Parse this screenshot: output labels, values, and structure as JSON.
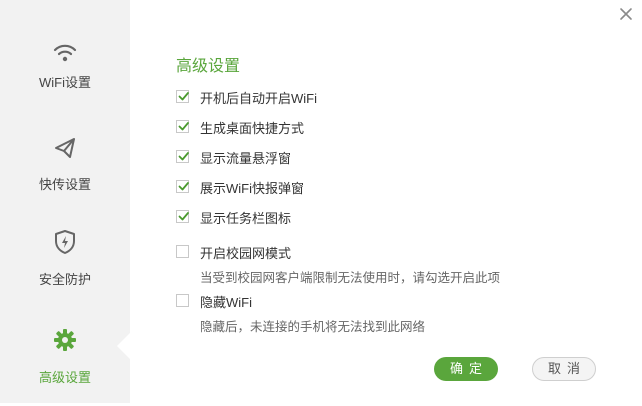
{
  "sidebar": {
    "items": [
      {
        "label": "WiFi设置",
        "icon": "wifi-icon",
        "active": false
      },
      {
        "label": "快传设置",
        "icon": "paper-plane-icon",
        "active": false
      },
      {
        "label": "安全防护",
        "icon": "shield-bolt-icon",
        "active": false
      },
      {
        "label": "高级设置",
        "icon": "gear-icon",
        "active": true
      }
    ]
  },
  "main": {
    "title": "高级设置",
    "options": [
      {
        "label": "开机后自动开启WiFi",
        "checked": true
      },
      {
        "label": "生成桌面快捷方式",
        "checked": true
      },
      {
        "label": "显示流量悬浮窗",
        "checked": true
      },
      {
        "label": "展示WiFi快报弹窗",
        "checked": true
      },
      {
        "label": "显示任务栏图标",
        "checked": true
      },
      {
        "label": "开启校园网模式",
        "checked": false,
        "description": "当受到校园网客户端限制无法使用时，请勾选开启此项"
      },
      {
        "label": "隐藏WiFi",
        "checked": false,
        "description": "隐藏后，未连接的手机将无法找到此网络"
      }
    ]
  },
  "buttons": {
    "ok": "确定",
    "cancel": "取消"
  },
  "colors": {
    "accent": "#5aa63c",
    "sidebar_bg": "#f2f2f2"
  }
}
